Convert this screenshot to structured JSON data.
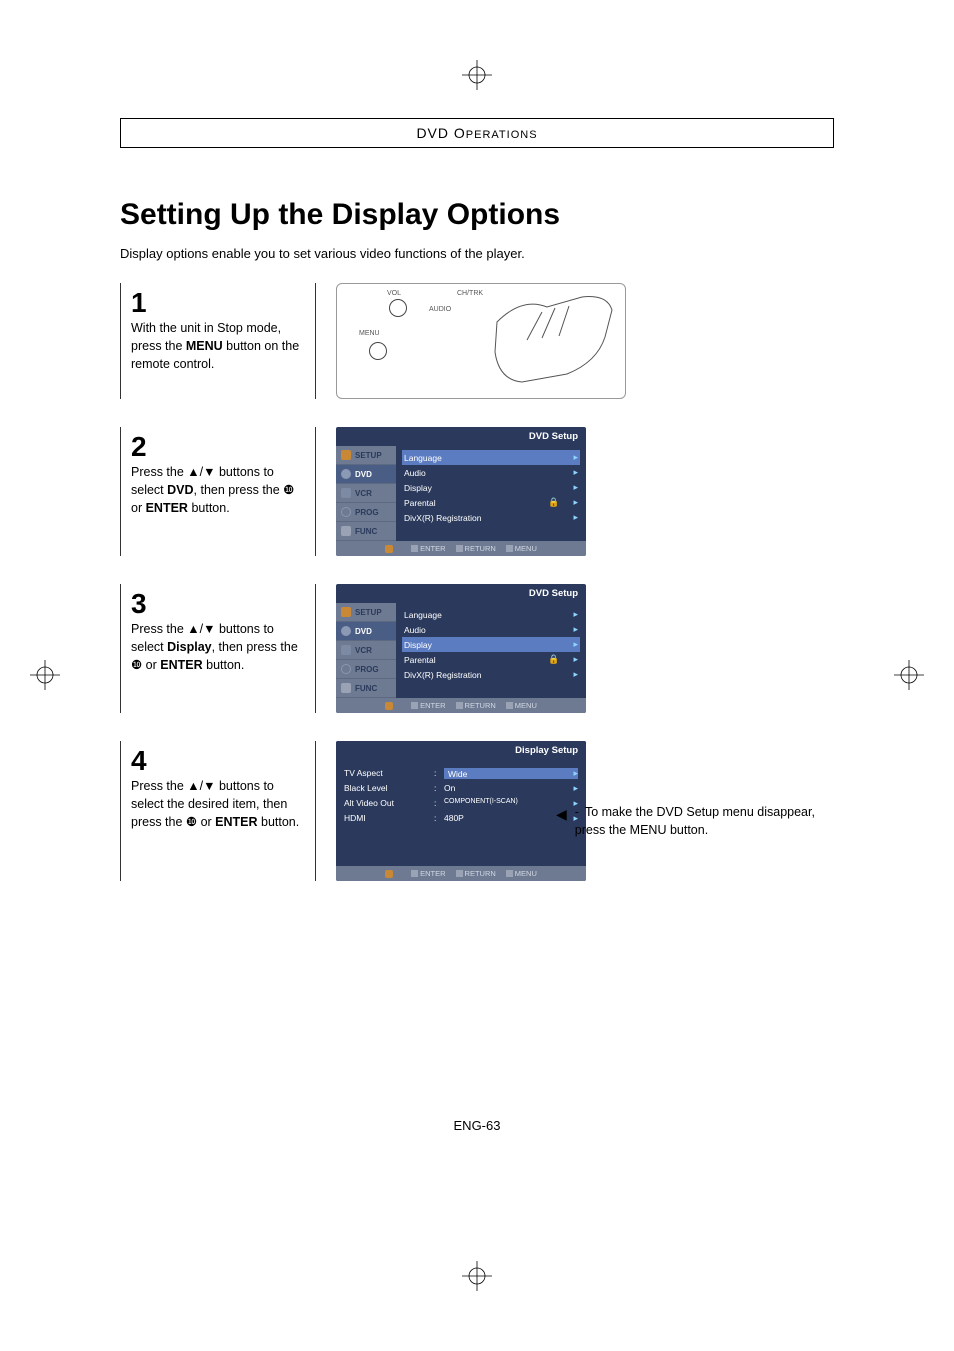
{
  "section_header": {
    "prefix": "DVD O",
    "suffix": "PERATIONS"
  },
  "title": "Setting Up the Display Options",
  "intro": "Display options enable you to set various video functions of the player.",
  "steps": {
    "s1": {
      "num": "1",
      "desc_pre": "With the unit in Stop mode, press the ",
      "desc_bold": "MENU",
      "desc_post": " button on the remote control."
    },
    "s2": {
      "num": "2",
      "desc_pre": "Press the ▲/▼ buttons to select ",
      "desc_bold": "DVD",
      "desc_mid": ", then press the ❿ or ",
      "desc_bold2": "ENTER",
      "desc_post": " button."
    },
    "s3": {
      "num": "3",
      "desc_pre": "Press the ▲/▼ buttons to select ",
      "desc_bold": "Display",
      "desc_mid": ", then press the ❿ or ",
      "desc_bold2": "ENTER",
      "desc_post": " button."
    },
    "s4": {
      "num": "4",
      "desc_pre": "Press the ▲/▼ buttons to select the desired item, then press the ❿ or ",
      "desc_bold": "ENTER",
      "desc_post": " button."
    }
  },
  "remote": {
    "vol": "VOL",
    "chtrk": "CH/TRK",
    "audio": "AUDIO",
    "menu": "MENU"
  },
  "osd_setup": {
    "title": "DVD Setup",
    "tabs": {
      "setup": "SETUP",
      "dvd": "DVD",
      "vcr": "VCR",
      "prog": "PROG",
      "func": "FUNC"
    },
    "items": {
      "language": "Language",
      "audio": "Audio",
      "display": "Display",
      "parental": "Parental",
      "divx": "DivX(R) Registration"
    },
    "footer": {
      "enter": "ENTER",
      "return": "RETURN",
      "menu": "MENU"
    }
  },
  "osd_display": {
    "title": "Display Setup",
    "rows": {
      "tv_aspect": {
        "label": "TV Aspect",
        "val": "Wide"
      },
      "black_level": {
        "label": "Black Level",
        "val": "On"
      },
      "alt_video": {
        "label": "Alt Video Out",
        "val": "COMPONENT(I-SCAN)"
      },
      "hdmi": {
        "label": "HDMI",
        "val": "480P"
      }
    },
    "footer": {
      "enter": "ENTER",
      "return": "RETURN",
      "menu": "MENU"
    }
  },
  "note": "To make the DVD Setup menu disappear, press the MENU button.",
  "page_number": "ENG-63"
}
